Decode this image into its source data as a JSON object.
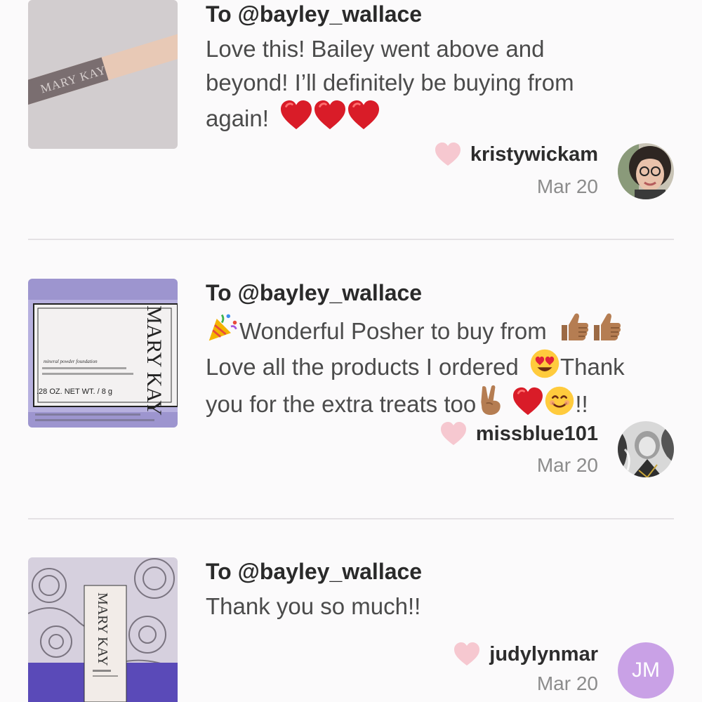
{
  "reviews": [
    {
      "recipient": "To @bayley_wallace",
      "lines": [
        "Love this! Bailey went above and",
        "beyond! I’ll definitely be buying from",
        "again!"
      ],
      "username": "kristywickam",
      "date": "Mar 20",
      "thumbnail_text": "MARY KAY"
    },
    {
      "recipient": "To @bayley_wallace",
      "lines": [
        "Wonderful Posher to buy from",
        "Love all the products I ordered",
        "Thank",
        "you for the extra treats too",
        "!!"
      ],
      "username": "missblue101",
      "date": "Mar 20",
      "thumbnail_text": "MARY KAY",
      "thumbnail_label": ".28 OZ. NET WT. / 8 g",
      "thumbnail_product": "mineral powder foundation"
    },
    {
      "recipient": "To @bayley_wallace",
      "lines": [
        "Thank you so much!!"
      ],
      "username": "judylynmar",
      "date": "Mar 20",
      "avatar_initials": "JM",
      "thumbnail_text": "MARY KAY"
    }
  ],
  "icons": {
    "like": "heart-outline-icon",
    "emoji_heart": "red-heart-emoji",
    "emoji_party": "party-popper-emoji",
    "emoji_thumbs": "thumbs-up-emoji",
    "emoji_hearteyes": "heart-eyes-emoji",
    "emoji_victory": "victory-hand-emoji",
    "emoji_smile": "smiling-face-emoji"
  },
  "colors": {
    "like_heart": "#f6c8d0",
    "emoji_red": "#d91c28",
    "avatar_jm": "#c9a1e6",
    "divider": "#e4e1e4"
  }
}
